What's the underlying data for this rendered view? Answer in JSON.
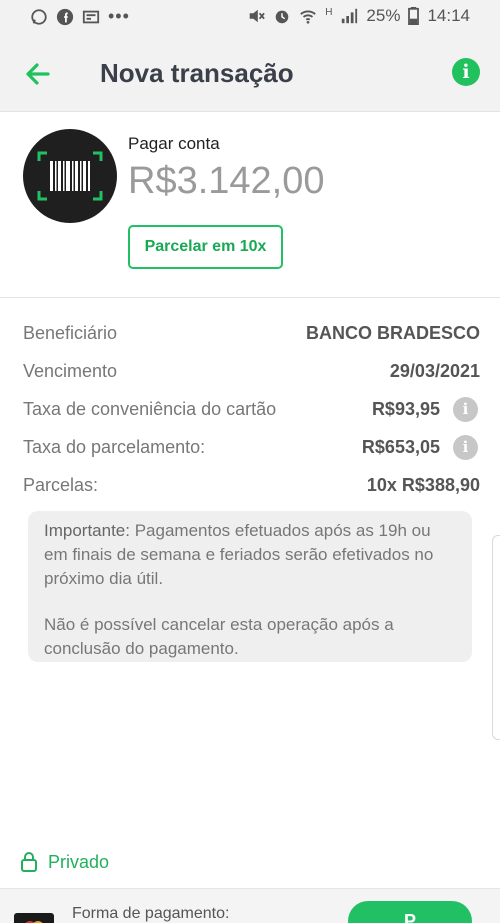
{
  "status_bar": {
    "battery": "25%",
    "time": "14:14",
    "network": "H",
    "left_icons": [
      "whatsapp-icon",
      "facebook-icon",
      "news-icon",
      "more-dots-icon"
    ],
    "right_icons": [
      "mute-icon",
      "alarm-icon",
      "wifi-icon",
      "signal-icon",
      "battery-icon"
    ]
  },
  "header": {
    "title": "Nova transação",
    "back_icon": "arrow-left-icon",
    "info_icon": "info-icon",
    "info_symbol": "i",
    "accent_color": "#21c25e"
  },
  "bill": {
    "label": "Pagar conta",
    "amount": "R$3.142,00",
    "installment_button": "Parcelar em 10x",
    "icon": "barcode-icon"
  },
  "details": [
    {
      "label": "Beneficiário",
      "value": "BANCO BRADESCO",
      "has_info": false
    },
    {
      "label": "Vencimento",
      "value": "29/03/2021",
      "has_info": false
    },
    {
      "label": "Taxa de conveniência do cartão",
      "value": "R$93,95",
      "has_info": true
    },
    {
      "label": "Taxa do parcelamento:",
      "value": "R$653,05",
      "has_info": true
    },
    {
      "label": "Parcelas:",
      "value": "10x R$388,90",
      "has_info": false
    }
  ],
  "notice": {
    "strong": "Importante:",
    "line1": " Pagamentos efetuados após as 19h ou em finais de semana e feriados serão efetivados no próximo dia útil.",
    "line2": "Não é possível cancelar esta operação após a conclusão do pagamento."
  },
  "privacy": {
    "label": "Privado",
    "icon": "lock-icon",
    "color": "#22b05c"
  },
  "payment": {
    "label": "Forma de pagamento:",
    "card_icon": "mastercard-icon",
    "button_label": "P"
  }
}
